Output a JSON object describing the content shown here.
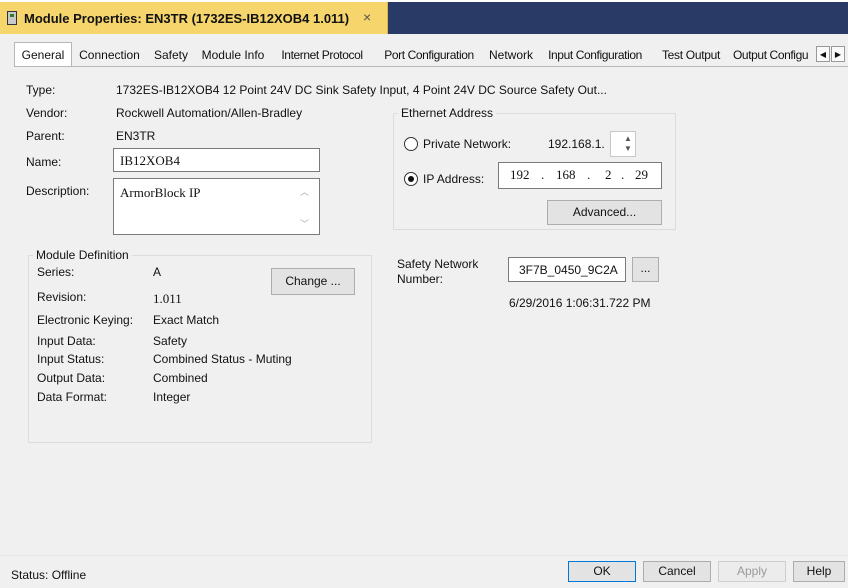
{
  "window": {
    "title": "Module Properties: EN3TR (1732ES-IB12XOB4 1.011)",
    "close_glyph": "×"
  },
  "tabs": [
    {
      "label": "General",
      "active": true
    },
    {
      "label": "Connection"
    },
    {
      "label": "Safety"
    },
    {
      "label": "Module Info"
    },
    {
      "label": "Internet Protocol"
    },
    {
      "label": "Port Configuration"
    },
    {
      "label": "Network"
    },
    {
      "label": "Input Configuration"
    },
    {
      "label": "Test Output"
    },
    {
      "label": "Output Configu"
    }
  ],
  "tab_scroll": {
    "left": "◀",
    "right": "▶"
  },
  "general": {
    "type_label": "Type:",
    "type_value": "1732ES-IB12XOB4 12 Point 24V DC Sink Safety Input, 4 Point 24V DC Source Safety Out...",
    "vendor_label": "Vendor:",
    "vendor_value": "Rockwell Automation/Allen-Bradley",
    "parent_label": "Parent:",
    "parent_value": "EN3TR",
    "name_label": "Name:",
    "name_value": "IB12XOB4",
    "description_label": "Description:",
    "description_value": "ArmorBlock IP"
  },
  "module_definition": {
    "title": "Module Definition",
    "change_button": "Change ...",
    "rows": [
      {
        "label": "Series:",
        "value": "A"
      },
      {
        "label": "Revision:",
        "value": "1.011"
      },
      {
        "label": "Electronic Keying:",
        "value": "Exact Match"
      },
      {
        "label": "Input Data:",
        "value": "Safety"
      },
      {
        "label": "Input Status:",
        "value": "Combined Status - Muting"
      },
      {
        "label": "Output Data:",
        "value": "Combined"
      },
      {
        "label": "Data Format:",
        "value": "Integer"
      }
    ]
  },
  "ethernet": {
    "title": "Ethernet Address",
    "private_label": "Private Network:",
    "private_prefix": "192.168.1.",
    "private_selected": false,
    "ip_label": "IP Address:",
    "ip_selected": true,
    "ip_octets": [
      "192",
      "168",
      "2",
      "29"
    ],
    "ip_dot": ".",
    "advanced_button": "Advanced..."
  },
  "safety_network": {
    "label_line1": "Safety Network",
    "label_line2": "Number:",
    "value": "3F7B_0450_9C2A",
    "browse_button": "...",
    "timestamp": "6/29/2016 1:06:31.722 PM"
  },
  "footer": {
    "status": "Status:  Offline",
    "ok": "OK",
    "cancel": "Cancel",
    "apply": "Apply",
    "help": "Help"
  }
}
